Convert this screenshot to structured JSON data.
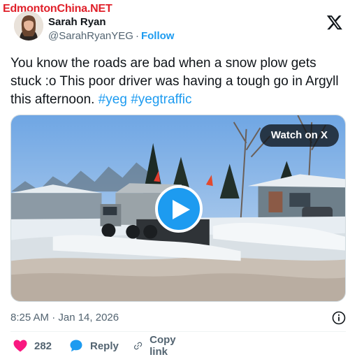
{
  "watermark": "EdmontonChina.NET",
  "author": {
    "name": "Sarah Ryan",
    "handle": "@SarahRyanYEG",
    "separator": "·",
    "follow_label": "Follow"
  },
  "tweet": {
    "text": "You know the roads are bad when a snow plow gets stuck :o This poor driver was having a tough go in Argyll this afternoon.",
    "hashtags": [
      "#yeg",
      "#yegtraffic"
    ]
  },
  "media": {
    "watch_label": "Watch on X",
    "play_icon": "play-icon"
  },
  "meta": {
    "timestamp": "8:25 AM · Jan 14, 2026"
  },
  "actions": {
    "like_count": "282",
    "reply_label": "Reply",
    "copy_label": "Copy link"
  },
  "colors": {
    "accent": "#1d9bf0",
    "like": "#f91880",
    "text": "#0f1419",
    "muted": "#536471"
  }
}
